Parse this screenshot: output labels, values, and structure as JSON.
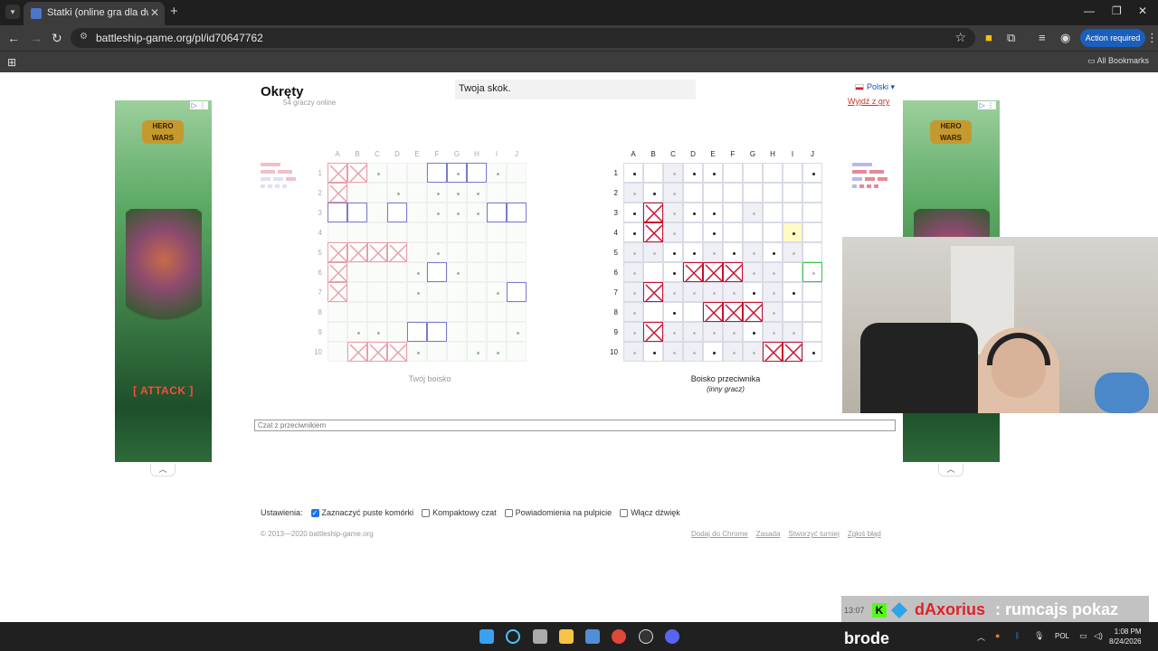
{
  "browser": {
    "tab_title": "Statki (online gra dla dwóch os",
    "url": "battleship-game.org/pl/id70647762",
    "action_required": "Action required",
    "all_bookmarks": "All Bookmarks"
  },
  "game": {
    "title": "Okręty",
    "online_count": "54 graczy online",
    "status": "Twoja skok.",
    "language": "Polski",
    "leave": "Wyjdź z gry",
    "columns": [
      "A",
      "B",
      "C",
      "D",
      "E",
      "F",
      "G",
      "H",
      "I",
      "J"
    ],
    "rows": [
      "1",
      "2",
      "3",
      "4",
      "5",
      "6",
      "7",
      "8",
      "9",
      "10"
    ],
    "my_board_caption": "Twój boisko",
    "enemy_board_caption": "Boisko przeciwnika",
    "enemy_board_subcaption": "(inny gracz)"
  },
  "chat": {
    "placeholder": "Czat z przeciwnikiem"
  },
  "settings": {
    "label": "Ustawienia:",
    "options": [
      {
        "label": "Zaznaczyć puste komórki",
        "checked": true
      },
      {
        "label": "Kompaktowy czat",
        "checked": false
      },
      {
        "label": "Powiadomienia na pulpicie",
        "checked": false
      },
      {
        "label": "Włącz dźwięk",
        "checked": false
      }
    ]
  },
  "footer": {
    "copyright": "© 2013—2020 battleship-game.org",
    "links": [
      "Dodaj do Chrome",
      "Zasada",
      "Stworzyć turniej",
      "Zgłoś błąd"
    ]
  },
  "ads": {
    "brand": "HERO WARS",
    "cta": "[ ATTACK ]"
  },
  "stream": {
    "chat_time": "13:07",
    "chat_user": "dAxorius",
    "chat_message": ": rumcajs pokaz",
    "bottom_label": "brode"
  },
  "taskbar": {
    "lang": "POL",
    "time": "1:08 PM",
    "date": "8/24/2026"
  },
  "colors": {
    "hit_mine": "#e8a0a8",
    "hit_enemy": "#c8102e",
    "own_ship": "#7a7ad0",
    "accent": "#1a73e8"
  },
  "my_board": {
    "ships_own": [
      [
        5,
        0
      ],
      [
        6,
        0
      ],
      [
        7,
        0
      ],
      [
        0,
        2
      ],
      [
        1,
        2
      ],
      [
        3,
        2
      ],
      [
        8,
        2
      ],
      [
        9,
        2
      ],
      [
        5,
        5
      ],
      [
        9,
        6
      ],
      [
        4,
        8
      ],
      [
        5,
        8
      ]
    ],
    "ships_hit": [
      [
        0,
        0
      ],
      [
        0,
        1
      ],
      [
        1,
        0
      ],
      [
        1,
        4
      ],
      [
        2,
        4
      ],
      [
        3,
        4
      ],
      [
        0,
        4
      ],
      [
        0,
        5
      ],
      [
        0,
        6
      ],
      [
        1,
        9
      ],
      [
        2,
        9
      ],
      [
        3,
        9
      ]
    ],
    "misses": [
      [
        2,
        0
      ],
      [
        6,
        0
      ],
      [
        8,
        0
      ],
      [
        3,
        1
      ],
      [
        5,
        1
      ],
      [
        6,
        1
      ],
      [
        7,
        1
      ],
      [
        5,
        2
      ],
      [
        6,
        2
      ],
      [
        7,
        2
      ],
      [
        5,
        4
      ],
      [
        6,
        5
      ],
      [
        8,
        6
      ],
      [
        4,
        5
      ],
      [
        4,
        6
      ],
      [
        2,
        8
      ],
      [
        9,
        8
      ],
      [
        1,
        8
      ],
      [
        7,
        9
      ],
      [
        8,
        9
      ],
      [
        4,
        9
      ]
    ]
  },
  "enemy_board": {
    "hits": [
      [
        1,
        2
      ],
      [
        1,
        3
      ],
      [
        3,
        5
      ],
      [
        4,
        5
      ],
      [
        5,
        5
      ],
      [
        1,
        6
      ],
      [
        4,
        7
      ],
      [
        5,
        7
      ],
      [
        6,
        7
      ],
      [
        1,
        8
      ],
      [
        7,
        9
      ],
      [
        8,
        9
      ]
    ],
    "misses": [
      [
        0,
        0
      ],
      [
        3,
        0
      ],
      [
        4,
        0
      ],
      [
        9,
        0
      ],
      [
        1,
        1
      ],
      [
        0,
        2
      ],
      [
        3,
        2
      ],
      [
        4,
        2
      ],
      [
        0,
        3
      ],
      [
        4,
        3
      ],
      [
        8,
        3
      ],
      [
        2,
        4
      ],
      [
        3,
        4
      ],
      [
        5,
        4
      ],
      [
        7,
        4
      ],
      [
        2,
        5
      ],
      [
        6,
        6
      ],
      [
        8,
        6
      ],
      [
        2,
        7
      ],
      [
        6,
        8
      ],
      [
        1,
        9
      ],
      [
        4,
        9
      ],
      [
        9,
        9
      ]
    ],
    "pale_misses": [
      [
        0,
        1
      ],
      [
        2,
        1
      ],
      [
        2,
        2
      ],
      [
        2,
        3
      ],
      [
        0,
        4
      ],
      [
        1,
        4
      ],
      [
        4,
        4
      ],
      [
        6,
        4
      ],
      [
        8,
        4
      ],
      [
        0,
        5
      ],
      [
        6,
        5
      ],
      [
        7,
        5
      ],
      [
        0,
        6
      ],
      [
        2,
        6
      ],
      [
        3,
        6
      ],
      [
        4,
        6
      ],
      [
        5,
        6
      ],
      [
        7,
        6
      ],
      [
        0,
        7
      ],
      [
        7,
        7
      ],
      [
        0,
        8
      ],
      [
        2,
        8
      ],
      [
        3,
        8
      ],
      [
        4,
        8
      ],
      [
        5,
        8
      ],
      [
        7,
        8
      ],
      [
        8,
        8
      ],
      [
        0,
        9
      ],
      [
        2,
        9
      ],
      [
        3,
        9
      ],
      [
        5,
        9
      ],
      [
        6,
        9
      ],
      [
        6,
        2
      ],
      [
        2,
        0
      ],
      [
        9,
        5
      ]
    ],
    "highlight": [
      8,
      3
    ],
    "cursor": [
      9,
      5
    ]
  }
}
